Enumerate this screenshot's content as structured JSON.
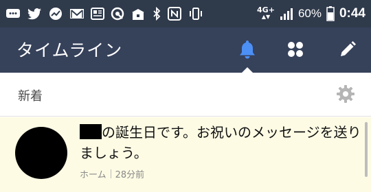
{
  "status_bar": {
    "network_label": "4G+",
    "battery_percent": "60%",
    "time": "0:44",
    "icons": [
      "messages-icon",
      "twitter-icon",
      "chart-app-icon",
      "gmail-icon",
      "news-icon",
      "quick-icon",
      "box-icon",
      "bluetooth-icon",
      "nfc-icon",
      "vibrate-icon",
      "signal-icon",
      "battery-icon"
    ]
  },
  "header": {
    "title": "タイムライン",
    "icons": [
      "bell-icon",
      "apps-grid-icon",
      "pencil-icon"
    ],
    "active_color": "#4c8ff5"
  },
  "section": {
    "label": "新着"
  },
  "notification": {
    "message_rest": "の誕生日です。お祝いのメッセージを送りましょう。",
    "source": "ホーム",
    "time_ago": "28分前",
    "background": "#fdfbe4"
  }
}
